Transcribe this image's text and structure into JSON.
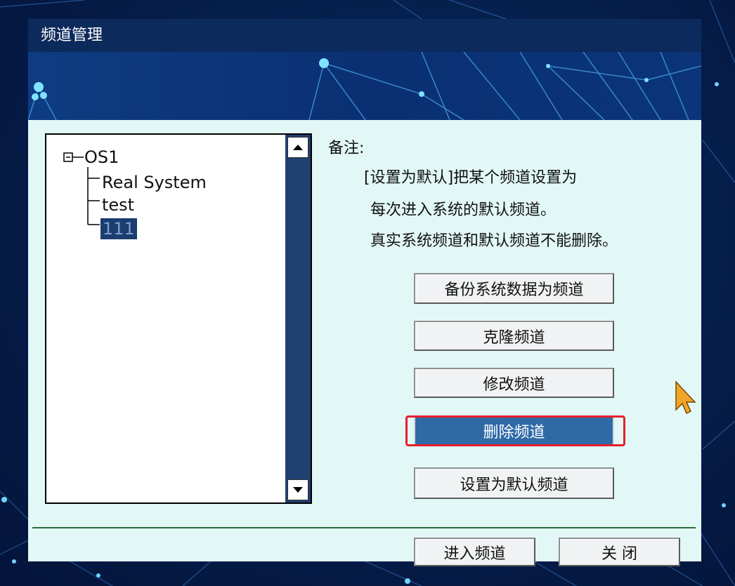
{
  "window": {
    "title": "频道管理"
  },
  "tree": {
    "root": {
      "expander": "⊟",
      "label": "OS1"
    },
    "children": [
      {
        "label": "Real System",
        "selected": false
      },
      {
        "label": "test",
        "selected": false
      },
      {
        "label": "111",
        "selected": true
      }
    ]
  },
  "notes": {
    "title": "备注:",
    "lines": [
      "[设置为默认]把某个频道设置为",
      "每次进入系统的默认频道。",
      "真实系统频道和默认频道不能删除。"
    ]
  },
  "actions": {
    "backup": "备份系统数据为频道",
    "clone": "克隆频道",
    "modify": "修改频道",
    "delete": "删除频道",
    "set_default": "设置为默认频道"
  },
  "footer": {
    "enter": "进入频道",
    "close": "关 闭"
  },
  "colors": {
    "selected_button": "#2f6aa7",
    "highlight_box": "#e5202a",
    "tree_selection": "#1c3d70"
  }
}
